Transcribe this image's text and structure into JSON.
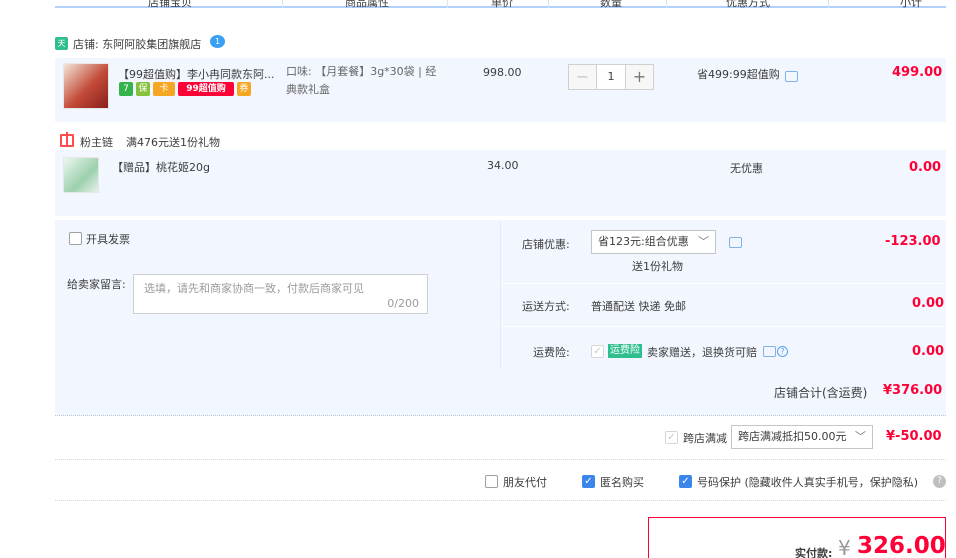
{
  "header": {
    "columns": [
      "店铺宝贝",
      "商品属性",
      "单价",
      "数量",
      "优惠方式",
      "小计"
    ]
  },
  "shop": {
    "icon_text": "天",
    "name": "店铺: 东阿阿胶集团旗舰店",
    "wangwang_icon": "chat-bubble-icon",
    "wangwang_text": "1"
  },
  "item1": {
    "title": "【99超值购】李小冉同款东阿...",
    "badges": [
      {
        "text": "7",
        "color": "#35b24a",
        "icon": "seven-day-return-icon"
      },
      {
        "text": "保",
        "color": "#85c13a",
        "icon": "guarantee-icon"
      },
      {
        "text": "卡",
        "color": "#f5a623",
        "icon": "card-icon"
      },
      {
        "text": "99超值购",
        "color": "#ff0036",
        "icon": "99-deal-icon"
      },
      {
        "text": "券",
        "color": "#f5a623",
        "icon": "coupon-icon"
      }
    ],
    "sku_line1": "口味: 【月套餐】3g*30袋 | 经",
    "sku_line2": "典款礼盒",
    "price": "998.00",
    "qty": "1",
    "qty_minus": "−",
    "qty_plus": "+",
    "discount": "省499:99超值购",
    "subtotal": "499.00"
  },
  "promo": {
    "label": "粉主链",
    "desc": "满476元送1份礼物"
  },
  "item2": {
    "title": "【赠品】桃花姬20g",
    "price": "34.00",
    "discount": "无优惠",
    "subtotal": "0.00"
  },
  "options": {
    "invoice_label": "开具发票",
    "message_label": "给卖家留言:",
    "message_placeholder": "选填，请先和商家协商一致，付款后商家可见",
    "message_count": "0/200",
    "shop_discount_label": "店铺优惠:",
    "shop_discount_select": "省123元:组合优惠",
    "shop_discount_sub": "送1份礼物",
    "shop_discount_amount": "-123.00",
    "shipping_label": "运送方式:",
    "shipping_value": "普通配送 快递 免邮",
    "shipping_amount": "0.00",
    "insurance_label": "运费险:",
    "insurance_tag": "运费险",
    "insurance_text": "卖家赠送，退换货可赔",
    "insurance_amount": "0.00"
  },
  "shop_total": {
    "label": "店铺合计(含运费)",
    "amount": "¥376.00"
  },
  "cross_store": {
    "label": "跨店满减",
    "select": "跨店满减抵扣50.00元",
    "amount": "¥-50.00"
  },
  "bottom_options": {
    "friend_pay": "朋友代付",
    "anonymous": "匿名购买",
    "number_protect": "号码保护 (隐藏收件人真实手机号，保护隐私)"
  },
  "payment": {
    "label": "实付款:",
    "currency": "¥",
    "amount": "326.00"
  },
  "colors": {
    "price_red": "#ff0036",
    "panel_bg": "#f2f7ff",
    "check_blue": "#3a86ea",
    "insurance_green": "#2fbf8f"
  }
}
